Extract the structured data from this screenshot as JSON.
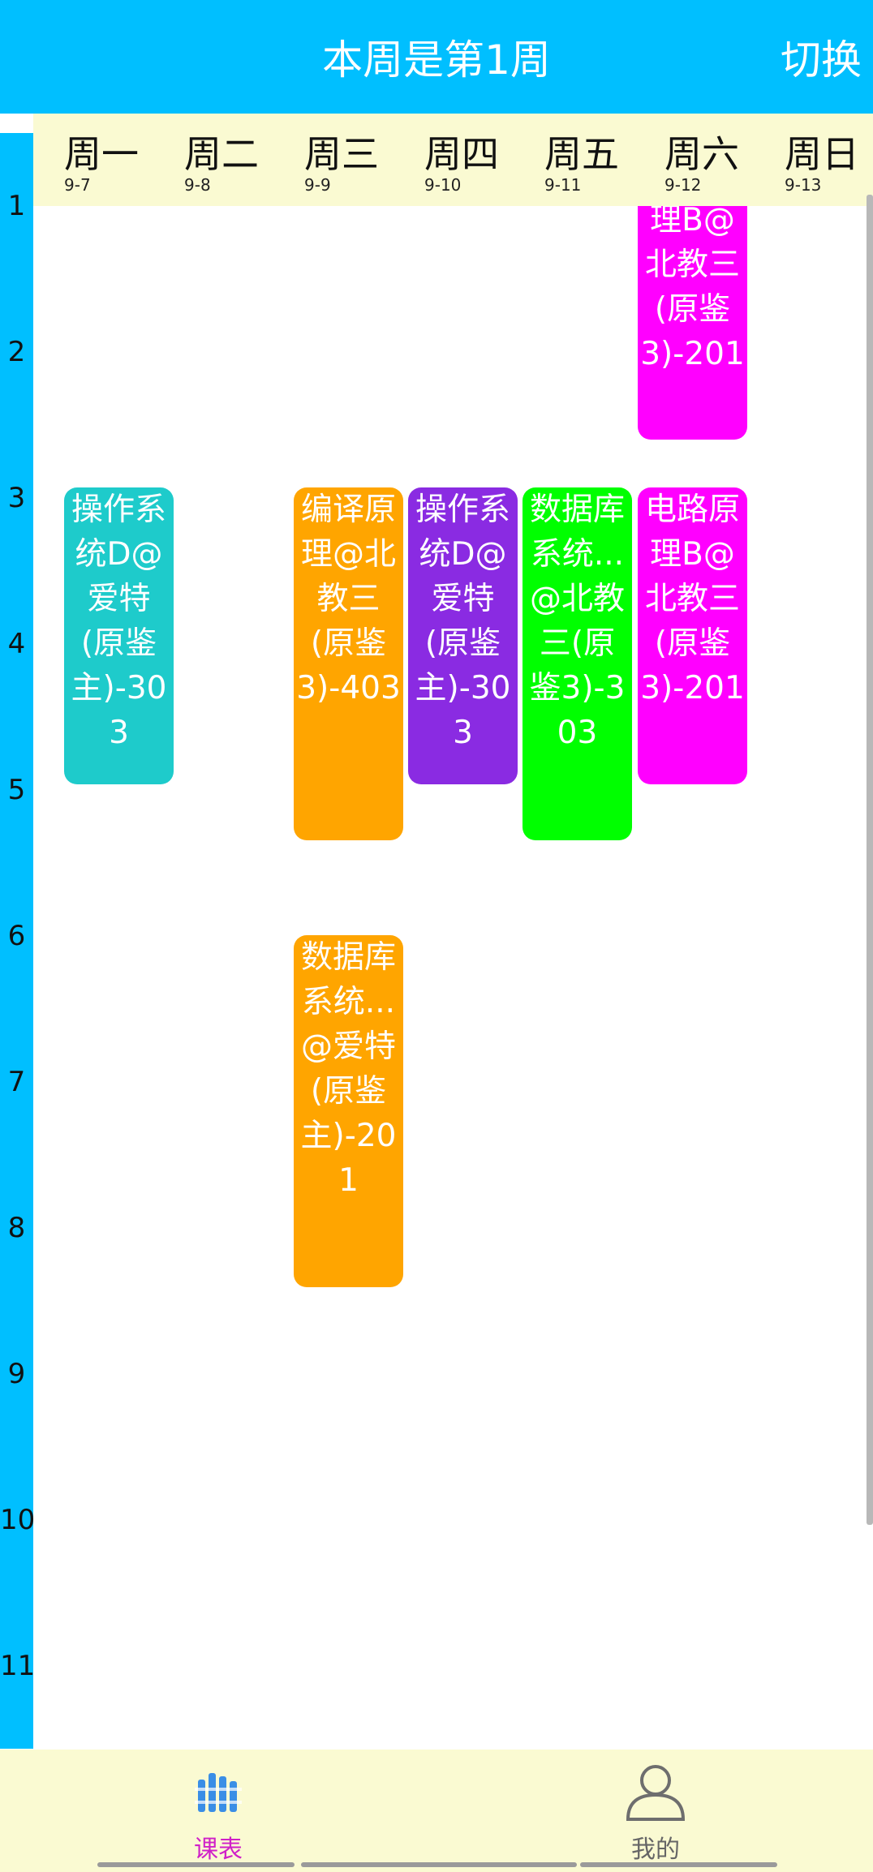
{
  "header": {
    "title": "本周是第1周",
    "switch_label": "切换"
  },
  "days": [
    {
      "name": "周一",
      "date": "9-7"
    },
    {
      "name": "周二",
      "date": "9-8"
    },
    {
      "name": "周三",
      "date": "9-9"
    },
    {
      "name": "周四",
      "date": "9-10"
    },
    {
      "name": "周五",
      "date": "9-11"
    },
    {
      "name": "周六",
      "date": "9-12"
    },
    {
      "name": "周日",
      "date": "9-13"
    }
  ],
  "periods": [
    "1",
    "2",
    "3",
    "4",
    "5",
    "6",
    "7",
    "8",
    "9",
    "10",
    "11"
  ],
  "courses": [
    {
      "text": "理B@北教三(原鉴3)-201",
      "color": "#ff00ff"
    },
    {
      "text": "操作系统D@爱特(原鉴主)-303",
      "color": "#1ecbcb"
    },
    {
      "text": "编译原理@北教三(原鉴3)-403",
      "color": "#ffa500"
    },
    {
      "text": "操作系统D@爱特(原鉴主)-303",
      "color": "#8a2be2"
    },
    {
      "text": "数据库系统...@北教三(原鉴3)-303",
      "color": "#00ff00"
    },
    {
      "text": "电路原理B@北教三(原鉴3)-201",
      "color": "#ff00ff"
    },
    {
      "text": "数据库系统...@爱特(原鉴主)-201",
      "color": "#ffa500"
    }
  ],
  "tabs": [
    {
      "label": "课表",
      "icon": "books-icon",
      "active": true,
      "color": "#d020c8"
    },
    {
      "label": "我的",
      "icon": "user-icon",
      "active": false,
      "color": "#666666"
    }
  ],
  "colors": {
    "accent": "#00bfff",
    "header_bg": "#fafad2"
  }
}
